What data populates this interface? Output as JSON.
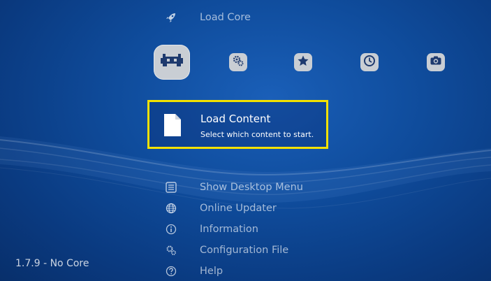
{
  "top_item": {
    "label": "Load Core",
    "icon": "rocket-icon"
  },
  "categories": [
    {
      "icon": "retroarch-invader-icon",
      "selected": true
    },
    {
      "icon": "settings-gears-icon"
    },
    {
      "icon": "star-icon"
    },
    {
      "icon": "clock-icon"
    },
    {
      "icon": "camera-icon"
    }
  ],
  "selected_item": {
    "title": "Load Content",
    "description": "Select which content to start.",
    "icon": "file-icon"
  },
  "menu": [
    {
      "label": "Show Desktop Menu",
      "icon": "list-icon"
    },
    {
      "label": "Online Updater",
      "icon": "globe-icon"
    },
    {
      "label": "Information",
      "icon": "info-icon"
    },
    {
      "label": "Configuration File",
      "icon": "gears-icon"
    },
    {
      "label": "Help",
      "icon": "help-icon"
    }
  ],
  "status": {
    "version_text": "1.7.9 - No Core"
  },
  "colors": {
    "highlight": "#f3e100",
    "background": "#0f4c9c"
  }
}
